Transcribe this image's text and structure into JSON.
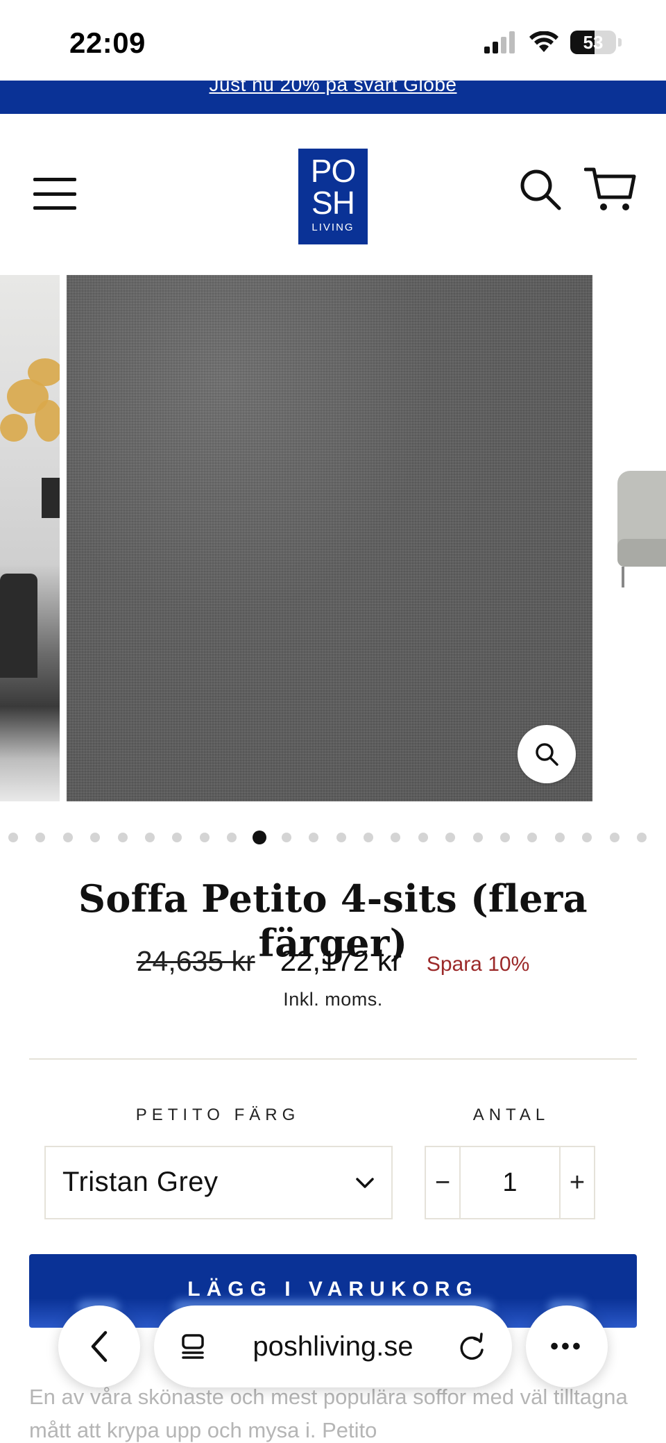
{
  "status_bar": {
    "time": "22:09",
    "battery": "53",
    "battery_level": 0.53
  },
  "announcement": {
    "text": "Just nu 20% på svart Globe"
  },
  "header": {
    "logo": {
      "line1": "PO",
      "line2": "SH",
      "line3": "LIVING"
    },
    "icons": [
      "menu-icon",
      "search-icon",
      "cart-icon"
    ],
    "brand_color": "#0a3296"
  },
  "gallery": {
    "slide_count": 24,
    "active_index": 9,
    "zoom_icon": "zoom-icon"
  },
  "product": {
    "title": "Soffa Petito 4-sits (flera färger)",
    "price_old": "24,635 kr",
    "price_new": "22,172 kr",
    "save": "Spara 10%",
    "tax_note": "Inkl. moms.",
    "save_color": "#9b2929"
  },
  "options": {
    "color_label": "PETITO FÄRG",
    "color_value": "Tristan Grey",
    "qty_label": "ANTAL",
    "qty_value": "1",
    "minus": "−",
    "plus": "+"
  },
  "add_to_cart": {
    "label": "LÄGG I VARUKORG"
  },
  "description": {
    "text": "En av våra skönaste och mest populära soffor med väl tilltagna mått att krypa upp och mysa i. Petito"
  },
  "browser": {
    "url": "poshliving.se",
    "more": "•••"
  }
}
